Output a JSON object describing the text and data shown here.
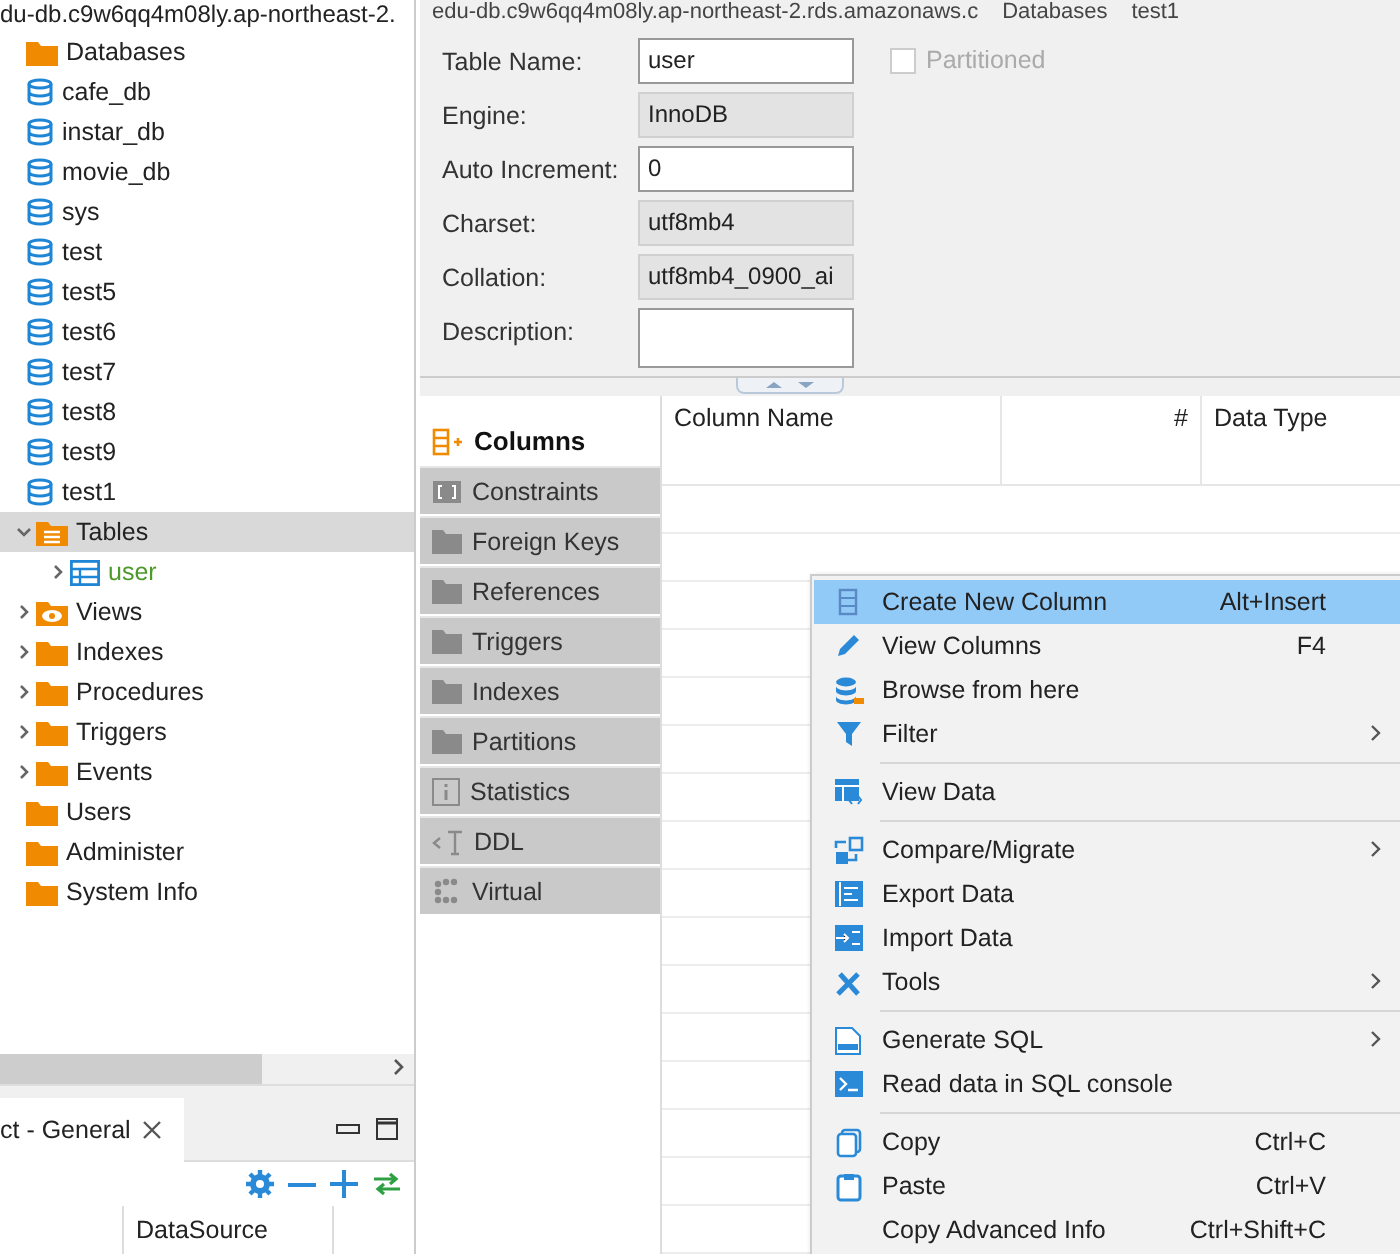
{
  "navigator": {
    "connection": "du-db.c9w6qq4m08ly.ap-northeast-2.",
    "tree": [
      {
        "label": "Databases",
        "kind": "folder",
        "selected": false,
        "children": [
          {
            "label": "cafe_db",
            "kind": "database",
            "selected": false
          },
          {
            "label": "instar_db",
            "kind": "database",
            "selected": false
          },
          {
            "label": "movie_db",
            "kind": "database",
            "selected": false
          },
          {
            "label": "sys",
            "kind": "database",
            "selected": false
          },
          {
            "label": "test",
            "kind": "database",
            "selected": false
          },
          {
            "label": "test5",
            "kind": "database",
            "selected": false
          },
          {
            "label": "test6",
            "kind": "database",
            "selected": false
          },
          {
            "label": "test7",
            "kind": "database",
            "selected": false
          },
          {
            "label": "test8",
            "kind": "database",
            "selected": false
          },
          {
            "label": "test9",
            "kind": "database",
            "selected": false
          },
          {
            "label": "test1",
            "kind": "database",
            "selected": false,
            "children": [
              {
                "label": "Tables",
                "kind": "tables",
                "expanded": true,
                "selected": true,
                "children": [
                  {
                    "label": "user",
                    "kind": "table",
                    "expanded": false,
                    "selected": false
                  }
                ]
              },
              {
                "label": "Views",
                "kind": "views",
                "expanded": false,
                "selected": false
              },
              {
                "label": "Indexes",
                "kind": "folder",
                "expanded": false,
                "selected": false
              },
              {
                "label": "Procedures",
                "kind": "folder",
                "expanded": false,
                "selected": false
              },
              {
                "label": "Triggers",
                "kind": "folder",
                "expanded": false,
                "selected": false
              },
              {
                "label": "Events",
                "kind": "folder",
                "expanded": false,
                "selected": false
              }
            ]
          }
        ]
      },
      {
        "label": "Users",
        "kind": "folder",
        "selected": false
      },
      {
        "label": "Administer",
        "kind": "folder",
        "selected": false
      },
      {
        "label": "System Info",
        "kind": "folder",
        "selected": false
      }
    ]
  },
  "properties_panel": {
    "tab": "ct - General",
    "column_header": "DataSource"
  },
  "breadcrumb": [
    "edu-db.c9w6qq4m08ly.ap-northeast-2.rds.amazonaws.c",
    "Databases",
    "test1"
  ],
  "form": {
    "fields": [
      {
        "label": "Table Name:",
        "value": "user",
        "kind": "input"
      },
      {
        "label": "Engine:",
        "value": "InnoDB",
        "kind": "readonly"
      },
      {
        "label": "Auto Increment:",
        "value": "0",
        "kind": "input"
      },
      {
        "label": "Charset:",
        "value": "utf8mb4",
        "kind": "readonly"
      },
      {
        "label": "Collation:",
        "value": "utf8mb4_0900_ai",
        "kind": "readonly"
      },
      {
        "label": "Description:",
        "kind": "textarea"
      }
    ],
    "partitioned": {
      "label": "Partitioned",
      "checked": false,
      "disabled": true
    }
  },
  "tabs": [
    {
      "label": "Columns",
      "kind": "columns",
      "selected": true
    },
    {
      "label": "Constraints",
      "kind": "constraints",
      "selected": false
    },
    {
      "label": "Foreign Keys",
      "kind": "folder",
      "selected": false
    },
    {
      "label": "References",
      "kind": "folder",
      "selected": false
    },
    {
      "label": "Triggers",
      "kind": "folder",
      "selected": false
    },
    {
      "label": "Indexes",
      "kind": "folder",
      "selected": false
    },
    {
      "label": "Partitions",
      "kind": "folder",
      "selected": false
    },
    {
      "label": "Statistics",
      "kind": "statistics",
      "selected": false
    },
    {
      "label": "DDL",
      "kind": "ddl",
      "selected": false
    },
    {
      "label": "Virtual",
      "kind": "virtual",
      "selected": false
    }
  ],
  "table": {
    "columns": [
      "Column Name",
      "#",
      "Data Type"
    ]
  },
  "context_menu": {
    "groups": [
      [
        {
          "label": "Create New Column",
          "shortcut": "Alt+Insert",
          "kind": "column",
          "submenu": false,
          "selected": true
        },
        {
          "label": "View Columns",
          "shortcut": "F4",
          "kind": "pencil",
          "submenu": false,
          "selected": false
        },
        {
          "label": "Browse from here",
          "kind": "browse",
          "submenu": false,
          "selected": false
        },
        {
          "label": "Filter",
          "kind": "filter",
          "submenu": true,
          "selected": false
        }
      ],
      [
        {
          "label": "View Data",
          "kind": "viewdata",
          "submenu": false,
          "selected": false
        }
      ],
      [
        {
          "label": "Compare/Migrate",
          "kind": "compare",
          "submenu": true,
          "selected": false
        },
        {
          "label": "Export Data",
          "kind": "export",
          "submenu": false,
          "selected": false
        },
        {
          "label": "Import Data",
          "kind": "import",
          "submenu": false,
          "selected": false
        },
        {
          "label": "Tools",
          "kind": "tools",
          "submenu": true,
          "selected": false
        }
      ],
      [
        {
          "label": "Generate SQL",
          "kind": "sql",
          "submenu": true,
          "selected": false
        },
        {
          "label": "Read data in SQL console",
          "kind": "console",
          "submenu": false,
          "selected": false
        }
      ],
      [
        {
          "label": "Copy",
          "shortcut": "Ctrl+C",
          "kind": "copy",
          "submenu": false,
          "selected": false
        },
        {
          "label": "Paste",
          "shortcut": "Ctrl+V",
          "kind": "paste",
          "submenu": false,
          "selected": false
        },
        {
          "label": "Copy Advanced Info",
          "shortcut": "Ctrl+Shift+C",
          "kind": "none",
          "submenu": false,
          "selected": false
        }
      ]
    ]
  }
}
